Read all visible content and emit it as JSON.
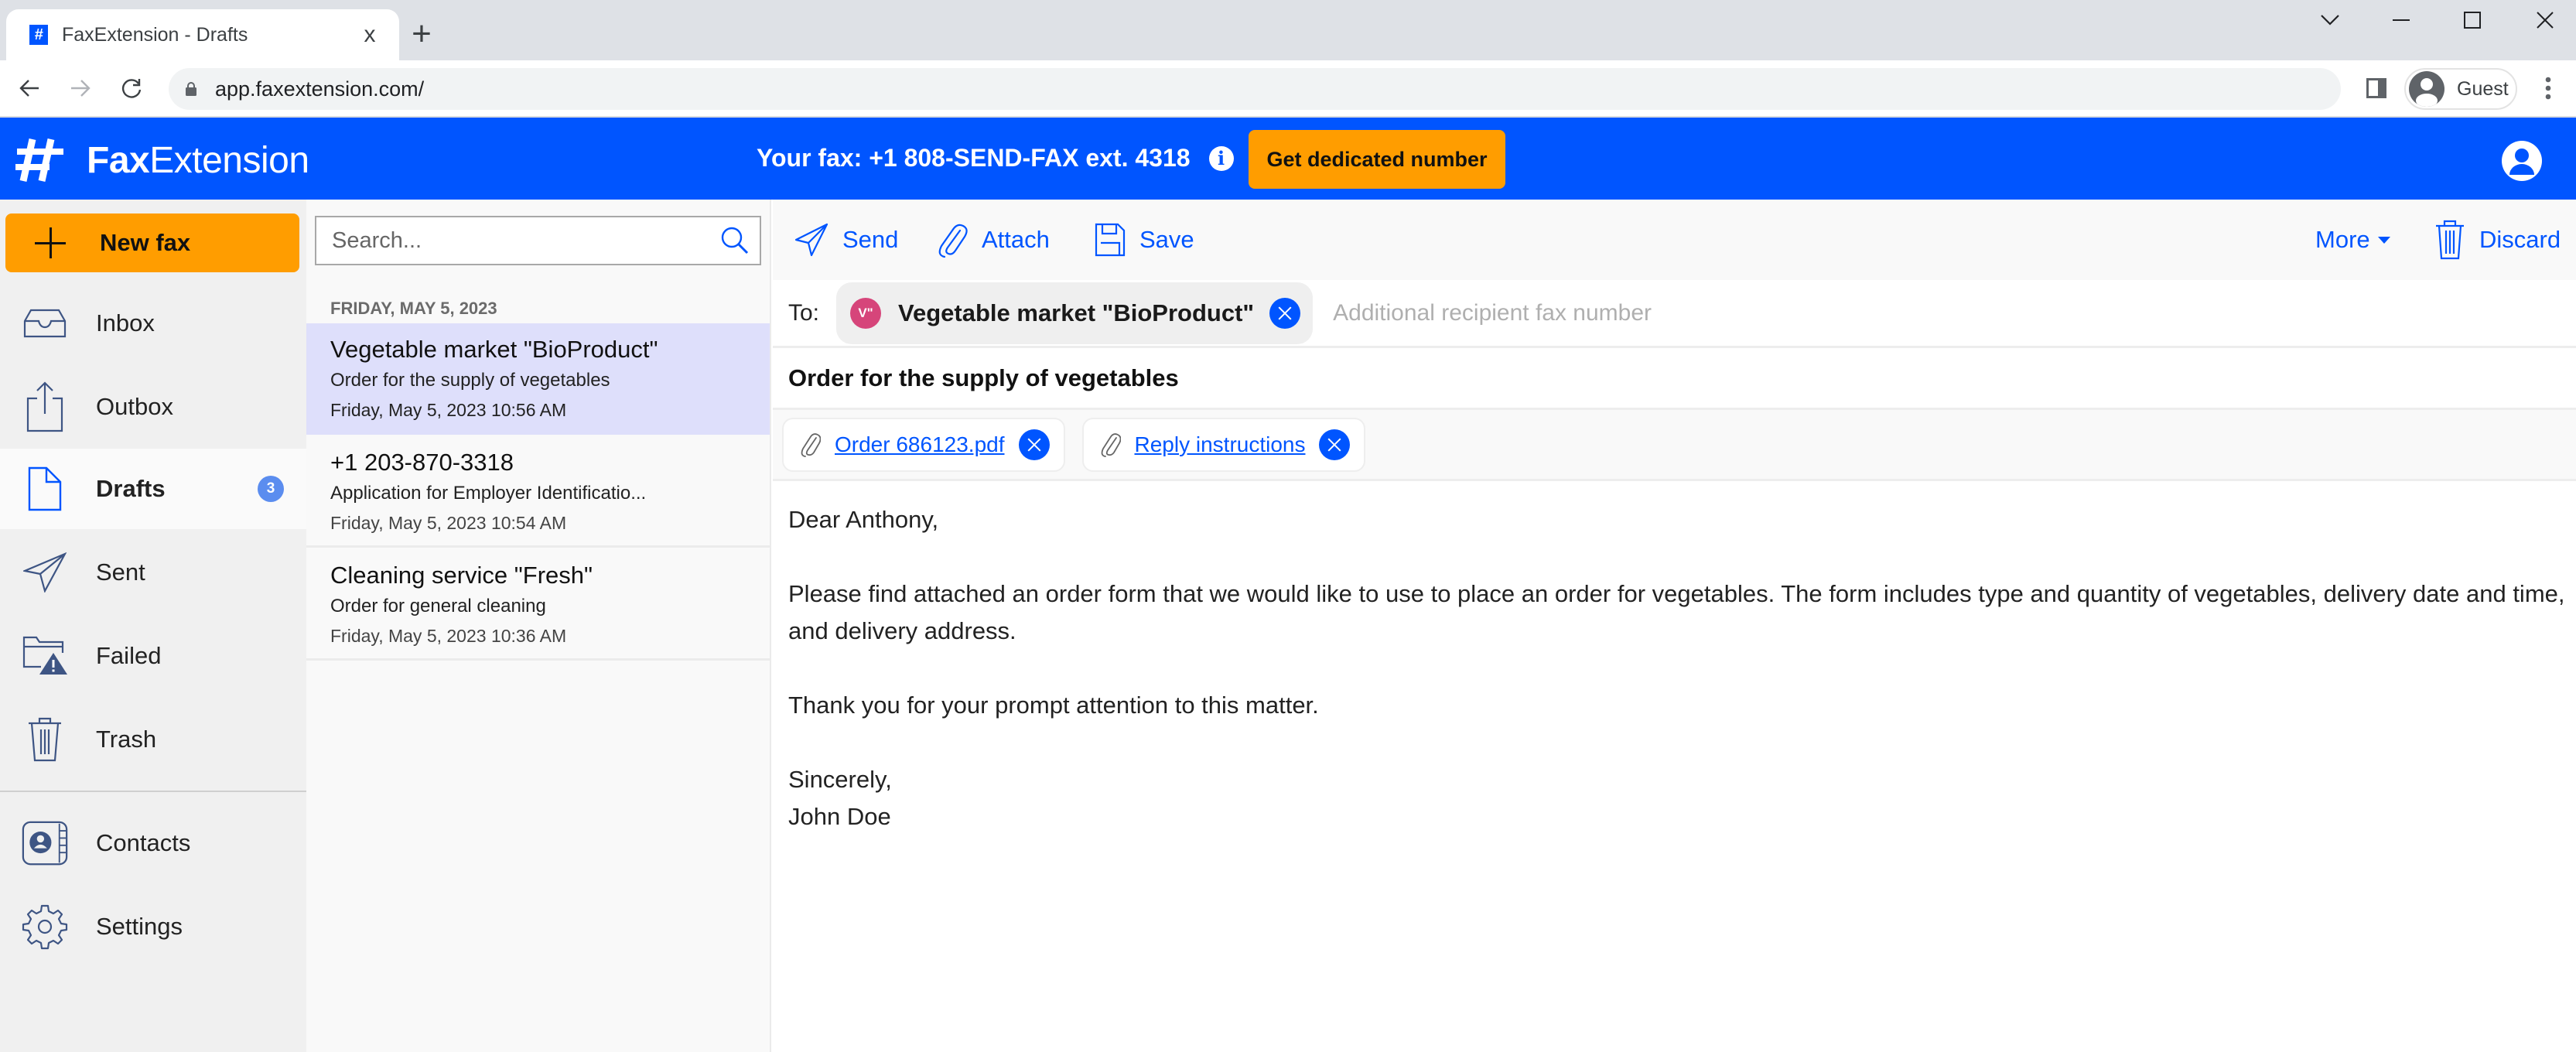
{
  "browser": {
    "tab_title": "FaxExtension - Drafts",
    "tab_close": "x",
    "new_tab": "+",
    "url": "app.faxextension.com/",
    "profile_name": "Guest"
  },
  "header": {
    "logo_bold": "Fax",
    "logo_rest": "Extension",
    "fax_line": "Your fax: +1 808-SEND-FAX ext. 4318",
    "info_glyph": "i",
    "cta_label": "Get dedicated number",
    "colors": {
      "brand": "#0055FF",
      "accent": "#FF9D00"
    }
  },
  "sidebar": {
    "new_fax_label": "New fax",
    "items": [
      {
        "id": "inbox",
        "label": "Inbox",
        "icon": "inbox-icon"
      },
      {
        "id": "outbox",
        "label": "Outbox",
        "icon": "outbox-icon"
      },
      {
        "id": "drafts",
        "label": "Drafts",
        "icon": "draft-icon",
        "badge": "3",
        "active": true
      },
      {
        "id": "sent",
        "label": "Sent",
        "icon": "paper-plane-icon"
      },
      {
        "id": "failed",
        "label": "Failed",
        "icon": "folder-warning-icon"
      },
      {
        "id": "trash",
        "label": "Trash",
        "icon": "trash-icon"
      },
      {
        "id": "contacts",
        "label": "Contacts",
        "icon": "contacts-book-icon"
      },
      {
        "id": "settings",
        "label": "Settings",
        "icon": "gear-icon"
      }
    ]
  },
  "list": {
    "search_placeholder": "Search...",
    "group_label": "FRIDAY, MAY 5, 2023",
    "items": [
      {
        "title": "Vegetable market \"BioProduct\"",
        "subject": "Order for the supply of vegetables",
        "time": "Friday, May 5, 2023 10:56 AM",
        "selected": true
      },
      {
        "title": "+1 203-870-3318",
        "subject": "Application for Employer Identificatio...",
        "time": "Friday, May 5, 2023 10:54 AM"
      },
      {
        "title": "Cleaning service \"Fresh\"",
        "subject": "Order for general cleaning",
        "time": "Friday, May 5, 2023 10:36 AM"
      }
    ]
  },
  "compose": {
    "toolbar": {
      "send": "Send",
      "attach": "Attach",
      "save": "Save",
      "more": "More",
      "discard": "Discard"
    },
    "to_label": "To:",
    "recipient": {
      "initials": "V\"",
      "name": "Vegetable market \"BioProduct\"",
      "avatar_color": "#D6457A"
    },
    "additional_placeholder": "Additional recipient fax number",
    "subject": "Order for the supply of vegetables",
    "attachments": [
      {
        "name": "Order 686123.pdf"
      },
      {
        "name": "Reply instructions"
      }
    ],
    "body": {
      "greeting": "Dear Anthony,",
      "paragraph": "Please find attached an order form that we would like to use to place an order for vegetables. The form includes type and quantity of vegetables, delivery date and time, and delivery address.",
      "thanks": "Thank you for your prompt attention to this matter.",
      "closing": "Sincerely,",
      "signature": "John Doe"
    }
  }
}
